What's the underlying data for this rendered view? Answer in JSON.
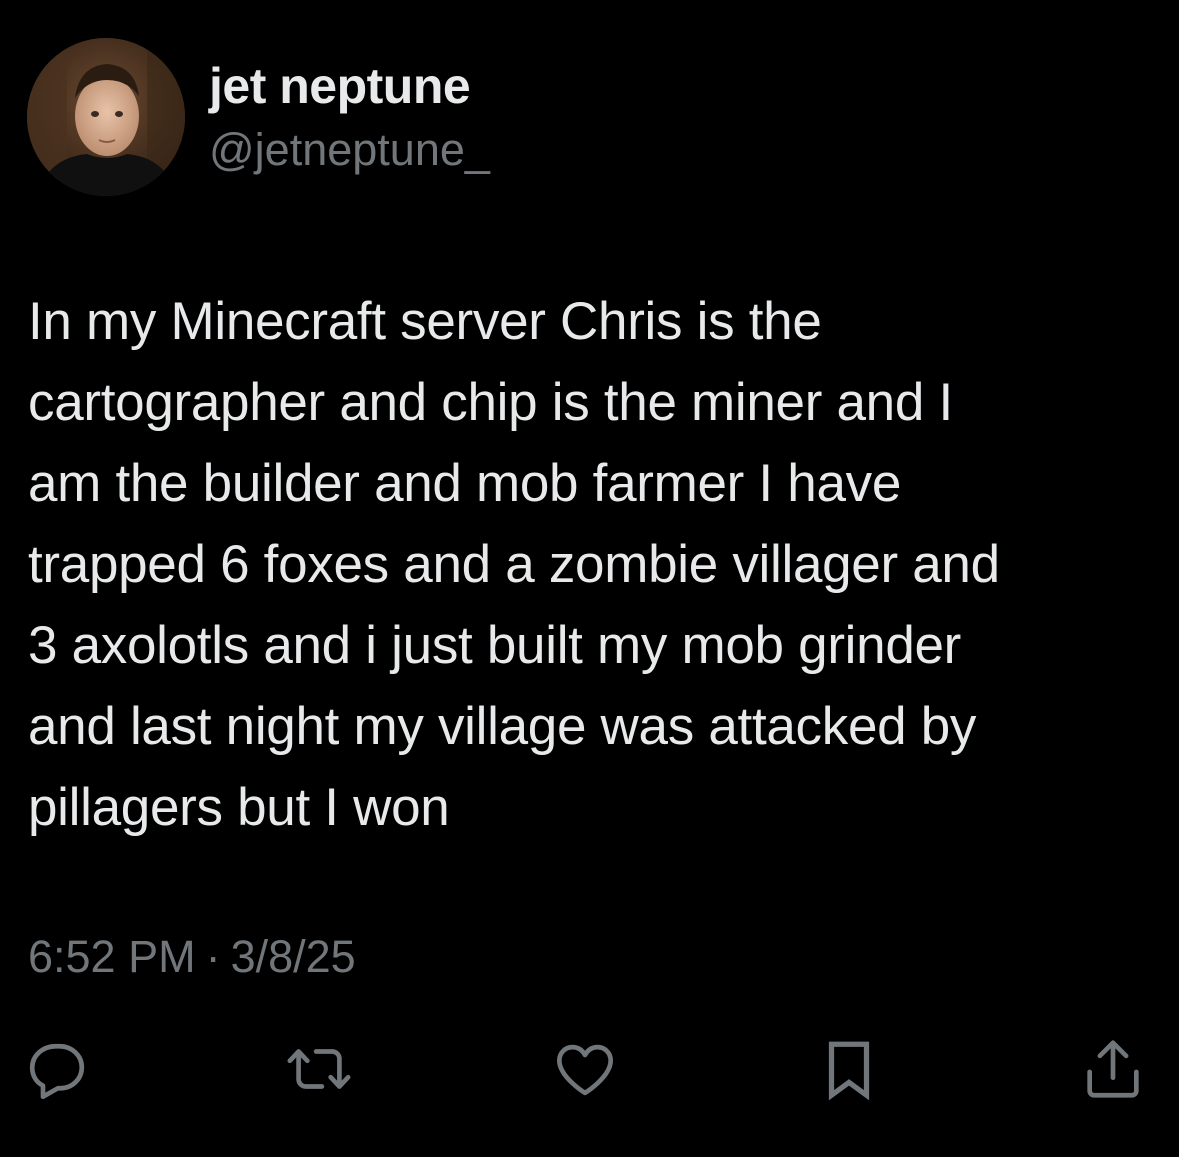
{
  "author": {
    "display_name": "jet neptune",
    "handle": "@jetneptune_"
  },
  "tweet": {
    "lines": [
      "In my Minecraft server Chris is the",
      "cartographer and chip is the miner and I",
      "am the builder and mob farmer I have",
      "trapped 6 foxes and a zombie villager and",
      "3 axolotls and i just built my mob grinder",
      "and last night my village was attacked by",
      "pillagers but I won"
    ],
    "time": "6:52 PM",
    "separator": "·",
    "date": "3/8/25"
  },
  "actions": [
    {
      "icon": "reply-icon"
    },
    {
      "icon": "retweet-icon"
    },
    {
      "icon": "like-icon"
    },
    {
      "icon": "bookmark-icon"
    },
    {
      "icon": "share-icon"
    }
  ],
  "colors": {
    "background": "#000000",
    "primary_text": "#e7e9ea",
    "secondary_text": "#71767b"
  }
}
